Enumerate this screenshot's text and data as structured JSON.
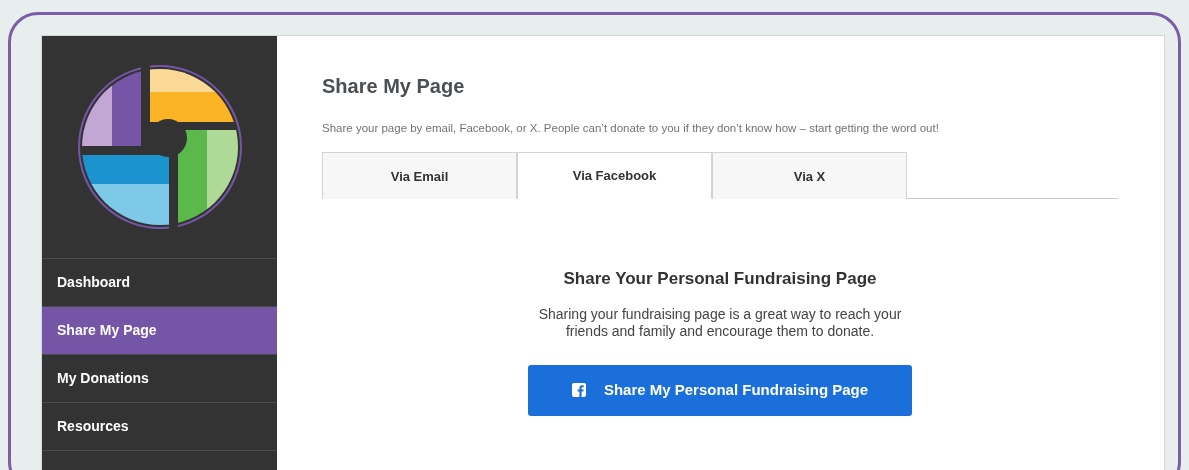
{
  "sidebar": {
    "items": [
      {
        "label": "Dashboard",
        "selected": false
      },
      {
        "label": "Share My Page",
        "selected": true
      },
      {
        "label": "My Donations",
        "selected": false
      },
      {
        "label": "Resources",
        "selected": false
      }
    ]
  },
  "main": {
    "title": "Share My Page",
    "description": "Share your page by email, Facebook, or X. People can’t donate to you if they don’t know how – start getting the word out!",
    "tabs": [
      {
        "label": "Via Email",
        "selected": false
      },
      {
        "label": "Via Facebook",
        "selected": true
      },
      {
        "label": "Via X",
        "selected": false
      }
    ],
    "panel": {
      "heading": "Share Your Personal Fundraising Page",
      "text": "Sharing your fundraising page is a great way to reach your friends and family and encourage them to donate.",
      "button": "Share My Personal Fundraising Page"
    }
  }
}
